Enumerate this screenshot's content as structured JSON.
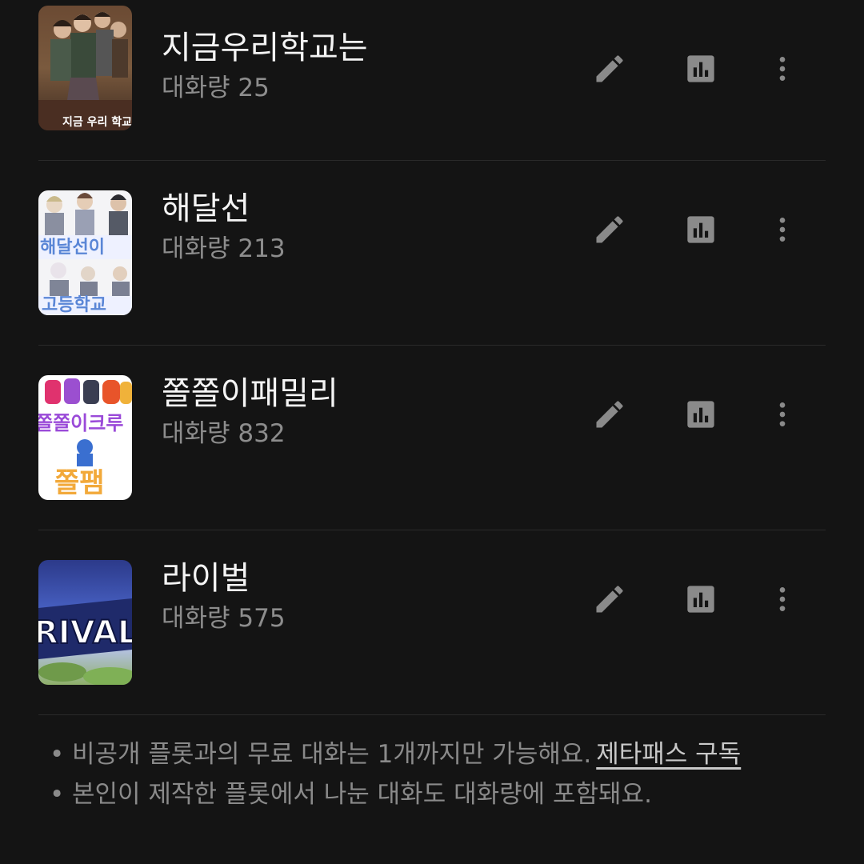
{
  "colors": {
    "background": "#141414",
    "title_text": "#f4f4f4",
    "secondary_text": "#8d8d8d",
    "icon": "#8a8a8a",
    "divider": "#2a2a2a",
    "link": "#c9c9c9"
  },
  "plots": [
    {
      "title": "지금우리학교는",
      "count": "대화량 25",
      "thumb_text": "지금 우리 학교는",
      "icons": [
        "pencil-icon",
        "bar-chart-icon",
        "more-vertical-icon"
      ]
    },
    {
      "title": "해달선",
      "count": "대화량 213",
      "thumb_text": "해달선이 고등학교",
      "icons": [
        "pencil-icon",
        "bar-chart-icon",
        "more-vertical-icon"
      ]
    },
    {
      "title": "쫄쫄이패밀리",
      "count": "대화량 832",
      "thumb_text": "쫄쫄이크루 쫄팸",
      "icons": [
        "pencil-icon",
        "bar-chart-icon",
        "more-vertical-icon"
      ]
    },
    {
      "title": "라이벌",
      "count": "대화량 575",
      "thumb_text": "RIVAL",
      "icons": [
        "pencil-icon",
        "bar-chart-icon",
        "more-vertical-icon"
      ]
    }
  ],
  "notes": {
    "bullet": "•",
    "line1": "비공개 플롯과의 무료 대화는 1개까지만 가능해요.",
    "line1_link": "제타패스 구독",
    "line2": "본인이 제작한 플롯에서 나눈 대화도 대화량에 포함돼요."
  }
}
